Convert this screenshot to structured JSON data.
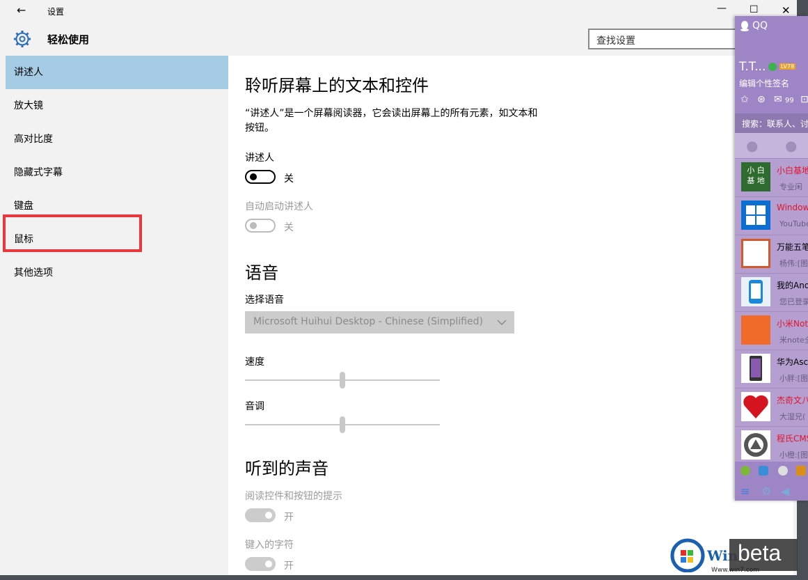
{
  "window": {
    "title": "设置",
    "controls": {
      "minimize": "—",
      "maximize": "☐",
      "close": "✕"
    },
    "back_glyph": "←"
  },
  "header": {
    "title": "轻松使用",
    "search_placeholder": "查找设置",
    "icon": "gear-icon"
  },
  "sidebar": {
    "items": [
      {
        "label": "讲述人",
        "selected": true
      },
      {
        "label": "放大镜"
      },
      {
        "label": "高对比度"
      },
      {
        "label": "隐藏式字幕"
      },
      {
        "label": "键盘"
      },
      {
        "label": "鼠标"
      },
      {
        "label": "其他选项"
      }
    ],
    "highlight_color": "#e8383d"
  },
  "content": {
    "section1": {
      "title": "聆听屏幕上的文本和控件",
      "desc_line1": "“讲述人”是一个屏幕阅读器，它会读出屏幕上的所有元素，如文本和",
      "desc_line2": "按钮。",
      "narrator_label": "讲述人",
      "narrator_state": "关",
      "autostart_label": "自动启动讲述人",
      "autostart_state": "关"
    },
    "section2": {
      "title": "语音",
      "voice_label": "选择语音",
      "voice_value": "Microsoft Huihui Desktop - Chinese (Simplified)",
      "speed_label": "速度",
      "pitch_label": "音调",
      "speed_value": 0.5,
      "pitch_value": 0.5
    },
    "section3": {
      "title": "听到的声音",
      "hints_label": "阅读控件和按钮的提示",
      "hints_state": "开",
      "typed_label": "键入的字符",
      "typed_state": "开"
    }
  },
  "qq": {
    "title": "QQ",
    "nickname": "T.T...",
    "level_badge": "LV78",
    "signature": "编辑个性签名",
    "mail_count": "99",
    "search_text": "搜索：联系人、讨",
    "contacts": [
      {
        "name": "小白基地",
        "sub": "专业闲",
        "red": true,
        "avatar_text": "小白\n基地"
      },
      {
        "name": "Window",
        "sub": "YouTube",
        "red": true
      },
      {
        "name": "万能五笔",
        "sub": "杨伟:[图"
      },
      {
        "name": "我的Andr",
        "sub": "您已登录"
      },
      {
        "name": "小米Note",
        "sub": "米note全",
        "red": true
      },
      {
        "name": "华为Asc",
        "sub": "小胖:[图"
      },
      {
        "name": "杰奇文八",
        "sub": "大湿兄(",
        "red": true
      },
      {
        "name": "程氏CMS",
        "sub": "小橙:[图",
        "red": true
      }
    ]
  },
  "watermark": {
    "beta": "beta",
    "site": "Www.win7.com",
    "brand": "Win"
  }
}
